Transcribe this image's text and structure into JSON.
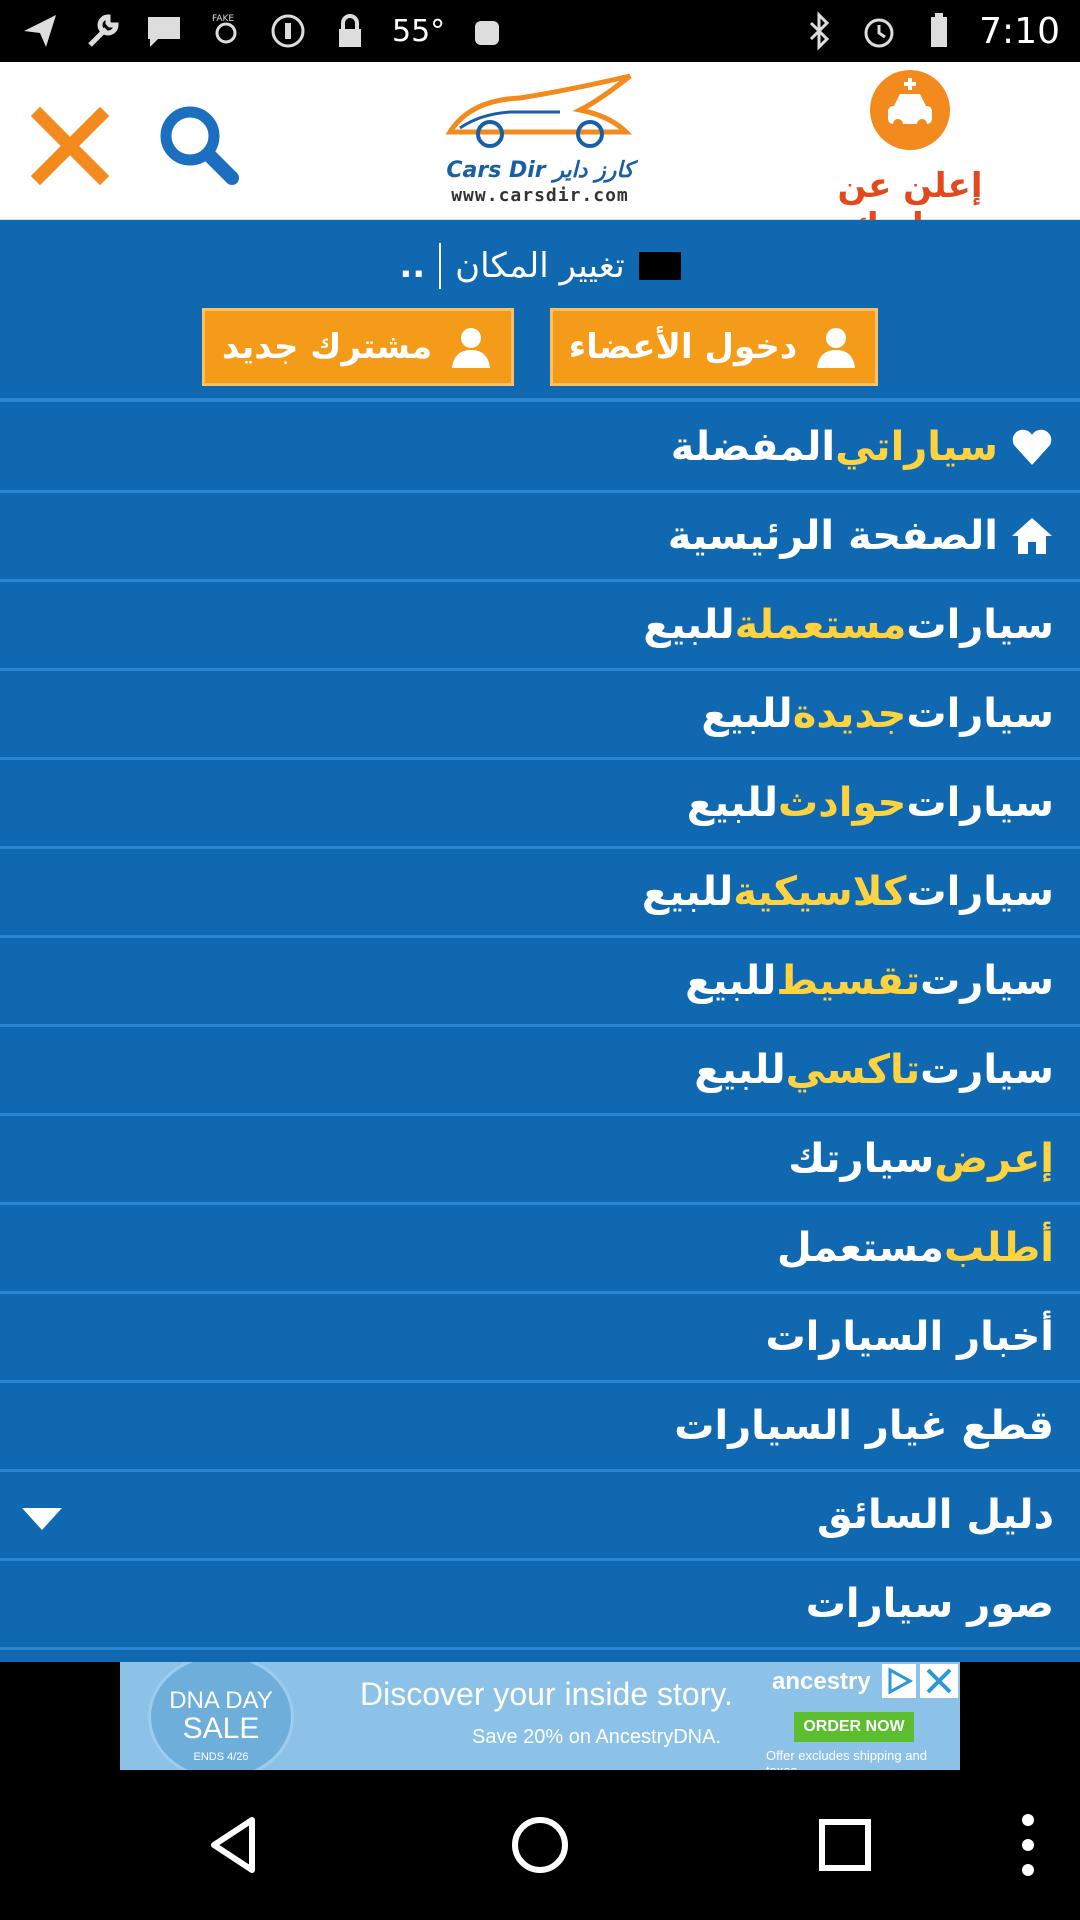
{
  "status_bar": {
    "temperature": "55°",
    "time": "7:10"
  },
  "header": {
    "logo_name": "Cars Dir كارز داير",
    "logo_url": "www.carsdir.com",
    "post_ad_label": "إعلن عن سيارتك"
  },
  "location": {
    "dots": "..",
    "label": "تغيير المكان"
  },
  "auth": {
    "login_label": "دخول الأعضاء",
    "register_label": "مشترك جديد"
  },
  "menu": {
    "items": [
      {
        "main": "سياراتي",
        "rest": " المفضلة",
        "icon": "heart-icon"
      },
      {
        "main": "الصفحة الرئيسية",
        "rest": "",
        "icon": "home-icon"
      },
      {
        "main": "سيارات ",
        "hl": "مستعملة",
        "rest": " للبيع"
      },
      {
        "main": "سيارات ",
        "hl": "جديدة",
        "rest": " للبيع"
      },
      {
        "main": "سيارات ",
        "hl": "حوادث",
        "rest": " للبيع"
      },
      {
        "main": "سيارات ",
        "hl": "كلاسيكية",
        "rest": " للبيع"
      },
      {
        "main": "سيارت ",
        "hl": "تقسيط",
        "rest": " للبيع"
      },
      {
        "main": "سيارت ",
        "hl": "تاكسي",
        "rest": " للبيع"
      },
      {
        "hl": "إعرض",
        "rest": " سيارتك"
      },
      {
        "hl": "أطلب",
        "rest": " مستعمل"
      },
      {
        "main": "أخبار السيارات"
      },
      {
        "main": "قطع غيار السيارات"
      },
      {
        "main": "دليل السائق",
        "icon": "chevron-down-icon"
      },
      {
        "main": "صور سيارات"
      }
    ]
  },
  "ad": {
    "sale_line1": "DNA DAY",
    "sale_line2": "SALE",
    "sale_ends": "ENDS 4/26",
    "headline": "Discover your inside story.",
    "sub": "Save 20% on AncestryDNA.",
    "brand": "ancestry",
    "order_label": "ORDER NOW",
    "fine_print": "Offer excludes shipping and taxes."
  },
  "colors": {
    "menu_bg": "#0f68b0",
    "highlight": "#ffd23f",
    "accent_orange": "#f49b1a",
    "close_orange": "#f28a1e",
    "search_blue": "#1c6fbf"
  }
}
